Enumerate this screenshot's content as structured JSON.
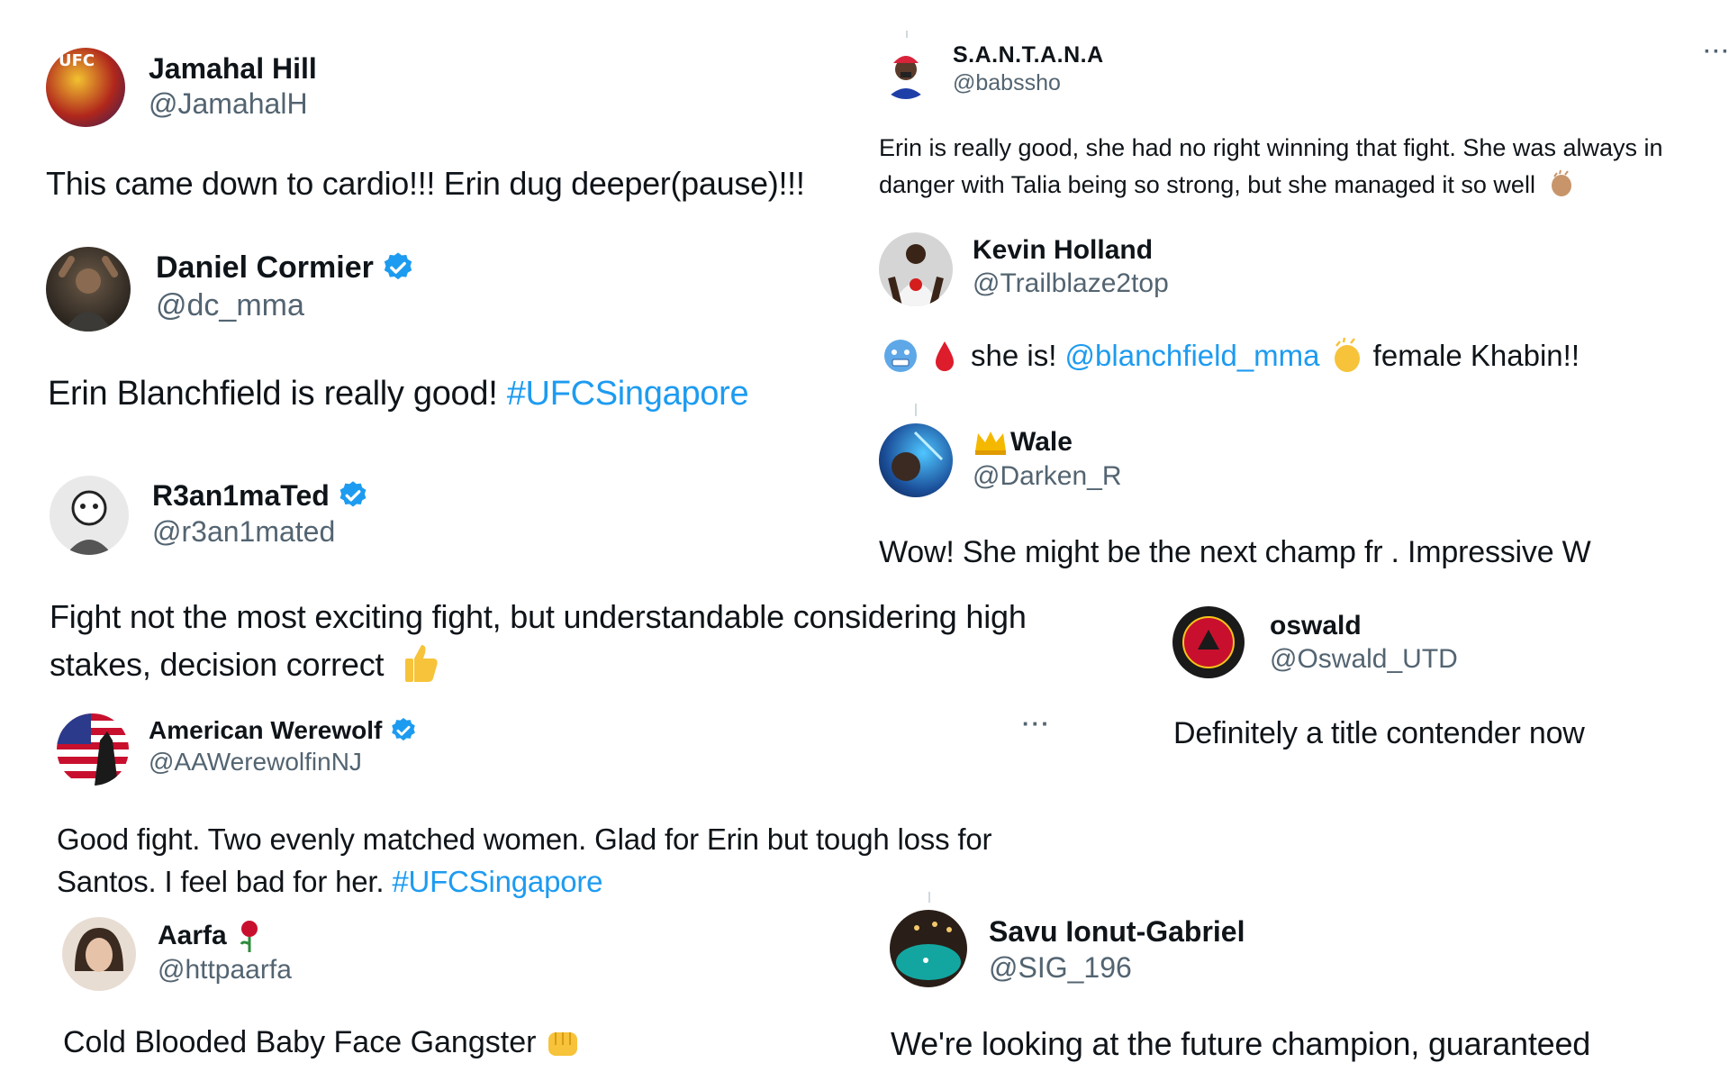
{
  "tweets": {
    "jamahal": {
      "name": "Jamahal Hill",
      "handle": "@JamahalH",
      "text": "This came down to cardio!!! Erin dug deeper(pause)!!!",
      "avatar_label": "UFC"
    },
    "santana": {
      "name": "S.A.N.T.A.N.A",
      "handle": "@babssho",
      "text_line1": "Erin is really good, she had no right winning that fight. She was always in",
      "text_line2": "danger with Talia being so strong, but she managed it so well",
      "more_label": "···"
    },
    "cormier": {
      "name": "Daniel Cormier",
      "handle": "@dc_mma",
      "text": "Erin Blanchfield is really good! ",
      "hashtag": "#UFCSingapore"
    },
    "holland": {
      "name": "Kevin Holland",
      "handle": "@Trailblaze2top",
      "text_pre": "she is! ",
      "mention": "@blanchfield_mma",
      "text_post": " female Khabin!!"
    },
    "wale": {
      "name": "Wale",
      "handle": "@Darken_R",
      "text": "Wow! She might be the next champ fr . Impressive W"
    },
    "r3an1mated": {
      "name": "R3an1maTed",
      "handle": "@r3an1mated",
      "text_line1": "Fight not the most exciting fight, but understandable considering high",
      "text_line2": "stakes, decision correct"
    },
    "oswald": {
      "name": "oswald",
      "handle": "@Oswald_UTD",
      "text": "Definitely a title contender now"
    },
    "werewolf": {
      "name": "American Werewolf",
      "handle": "@AAWerewolfinNJ",
      "text_line1": "Good fight. Two evenly matched women. Glad for Erin but tough loss for",
      "text_line2": "Santos. I feel bad for her. ",
      "hashtag": "#UFCSingapore",
      "more_label": "···"
    },
    "aarfa": {
      "name": "Aarfa",
      "handle": "@httpaarfa",
      "text": "Cold Blooded Baby Face Gangster"
    },
    "savu": {
      "name": "Savu Ionut-Gabriel",
      "handle": "@SIG_196",
      "text": "We're looking at the future champion, guaranteed"
    }
  },
  "colors": {
    "text": "#0f1419",
    "handle": "#536471",
    "link": "#1d9bf0",
    "verified": "#1d9bf0"
  },
  "icons": [
    "verified-badge-icon",
    "clap-emoji-icon",
    "blood-drop-emoji-icon",
    "cold-face-emoji-icon",
    "crown-emoji-icon",
    "thumbs-up-emoji-icon",
    "fist-emoji-icon",
    "rose-emoji-icon",
    "more-options-icon"
  ]
}
